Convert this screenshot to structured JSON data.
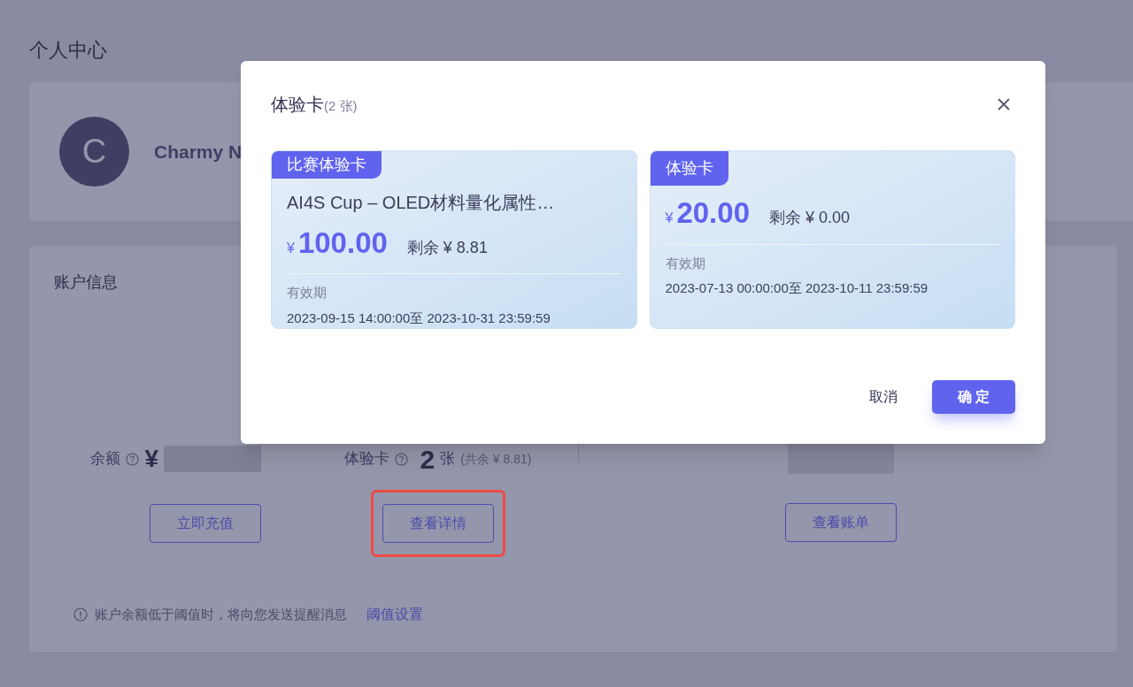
{
  "page": {
    "title": "个人中心"
  },
  "profile": {
    "avatar_initial": "C",
    "name": "Charmy N"
  },
  "account": {
    "title": "账户信息",
    "balance": {
      "label": "余额",
      "currency": "¥",
      "button": "立即充值"
    },
    "trial_cards": {
      "label": "体验卡",
      "count": "2",
      "unit": "张",
      "remaining": "(共余 ¥ 8.81)",
      "button": "查看详情",
      "highlighted": true
    },
    "bills": {
      "button": "查看账单"
    },
    "notice": {
      "text": "账户余额低于阈值时，将向您发送提醒消息",
      "link": "阈值设置"
    }
  },
  "dialog": {
    "title": "体验卡",
    "count": "(2 张)",
    "cards": [
      {
        "tag": "比赛体验卡",
        "name": "AI4S Cup – OLED材料量化属性…",
        "currency": "¥",
        "amount": "100.00",
        "remaining": "剩余 ¥ 8.81",
        "validity_label": "有效期",
        "validity": "2023-09-15 14:00:00至 2023-10-31 23:59:59"
      },
      {
        "tag": "体验卡",
        "currency": "¥",
        "amount": "20.00",
        "remaining": "剩余 ¥ 0.00",
        "validity_label": "有效期",
        "validity": "2023-07-13 00:00:00至 2023-10-11 23:59:59"
      }
    ],
    "buttons": {
      "cancel": "取消",
      "confirm": "确 定"
    }
  }
}
